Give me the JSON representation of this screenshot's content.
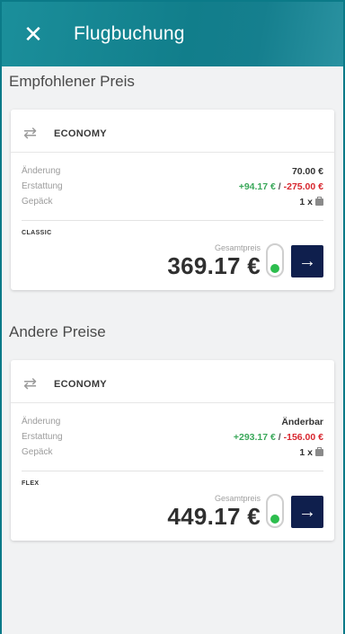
{
  "appbar": {
    "title": "Flugbuchung",
    "close_icon": "close-icon"
  },
  "recommended": {
    "section_title": "Empfohlener Preis",
    "card": {
      "cabin": "ECONOMY",
      "rows": {
        "change": {
          "label": "Änderung",
          "value": "70.00 €"
        },
        "refund": {
          "label": "Erstattung",
          "positive": "+94.17 €",
          "separator": "/",
          "negative": "-275.00 €"
        },
        "baggage": {
          "label": "Gepäck",
          "value": "1 x"
        }
      },
      "fare_name": "CLASSIC",
      "price_label": "Gesamtpreis",
      "price": "369.17 €",
      "indicator_colors": {
        "on": "#2dbd4e",
        "off": "#ffffff"
      }
    }
  },
  "others": {
    "section_title": "Andere Preise",
    "card": {
      "cabin": "ECONOMY",
      "rows": {
        "change": {
          "label": "Änderung",
          "value": "Änderbar"
        },
        "refund": {
          "label": "Erstattung",
          "positive": "+293.17 €",
          "separator": "/",
          "negative": "-156.00 €"
        },
        "baggage": {
          "label": "Gepäck",
          "value": "1 x"
        }
      },
      "fare_name": "FLEX",
      "price_label": "Gesamtpreis",
      "price": "449.17 €"
    }
  },
  "colors": {
    "appbar": "#117e8b",
    "button": "#0f1f4d",
    "positive": "#3aa85a",
    "negative": "#d8262e"
  }
}
